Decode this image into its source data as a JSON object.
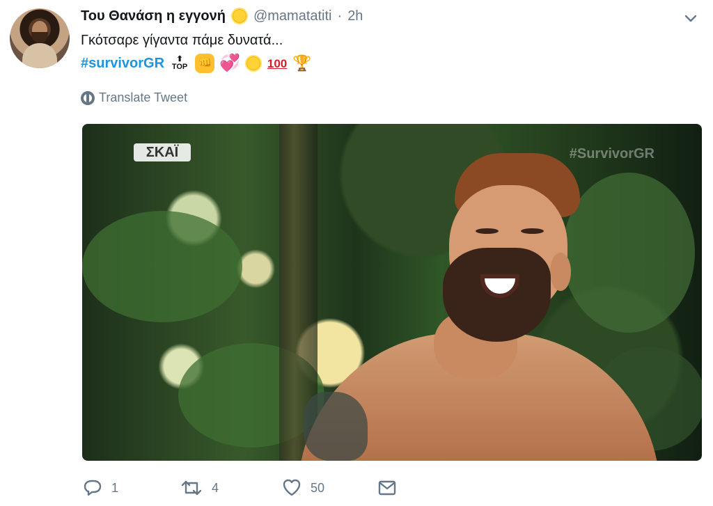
{
  "tweet": {
    "display_name": "Του Θανάση η εγγονή",
    "handle": "@mamatatiti",
    "separator": "·",
    "time": "2h",
    "text": "Γκότσαρε γίγαντα πάμε δυνατά...",
    "hashtag": "#survivorGR",
    "emojis": {
      "top": "TOP",
      "fist": "👊",
      "heart": "💞",
      "sun": "☀",
      "hundred": "100",
      "trophy": "🏆"
    },
    "translate_label": "Translate Tweet"
  },
  "media": {
    "channel_label": "ΣΚΑΪ",
    "watermark": "#SurvivorGR"
  },
  "actions": {
    "reply_count": "1",
    "retweet_count": "4",
    "like_count": "50"
  },
  "colors": {
    "link": "#1b95e0",
    "muted": "#657786",
    "text": "#14171a"
  },
  "icons": {
    "avatar": "avatar",
    "verified_badge": "sun-emoji",
    "menu": "chevron-down-icon",
    "translate": "globe-icon",
    "reply": "reply-icon",
    "retweet": "retweet-icon",
    "like": "heart-icon",
    "message": "envelope-icon"
  }
}
